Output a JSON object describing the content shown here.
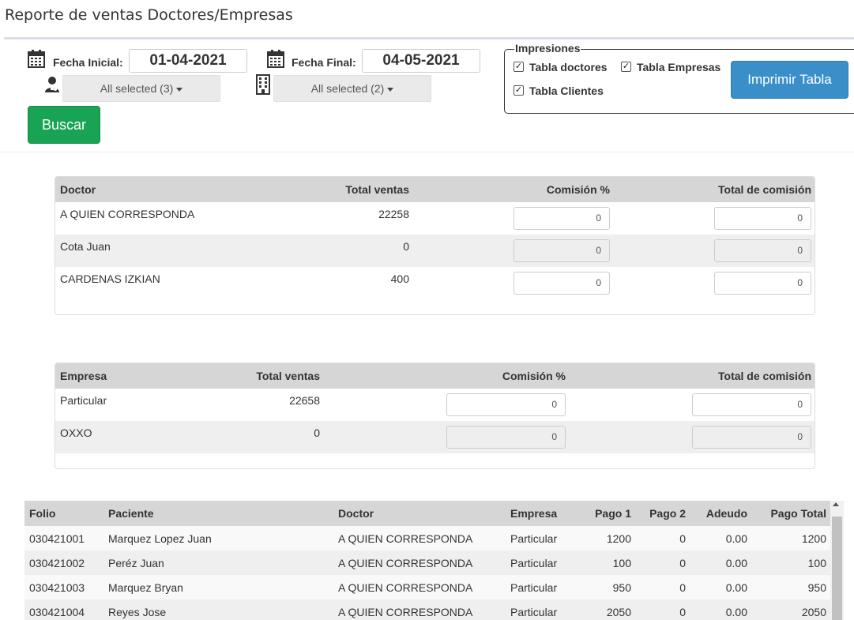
{
  "page": {
    "title": "Reporte de ventas Doctores/Empresas"
  },
  "filters": {
    "fecha_inicial_label": "Fecha Inicial:",
    "fecha_inicial_value": "01-04-2021",
    "fecha_final_label": "Fecha Final:",
    "fecha_final_value": "04-05-2021",
    "doctors_select": "All selected (3)",
    "companies_select": "All selected (2)",
    "buscar_label": "Buscar"
  },
  "impresiones": {
    "legend": "Impresiones",
    "tabla_doctores": "Tabla doctores",
    "tabla_empresas": "Tabla Empresas",
    "tabla_clientes": "Tabla Clientes",
    "check_mark": "✓",
    "print_label": "Imprimir Tabla"
  },
  "doctors_table": {
    "headers": [
      "Doctor",
      "Total ventas",
      "Comisión %",
      "Total de comisión"
    ],
    "rows": [
      {
        "doctor": "A QUIEN CORRESPONDA",
        "total": "22258",
        "comision": "0",
        "total_comision": "0"
      },
      {
        "doctor": "Cota Juan",
        "total": "0",
        "comision": "0",
        "total_comision": "0"
      },
      {
        "doctor": "CARDENAS IZKIAN",
        "total": "400",
        "comision": "0",
        "total_comision": "0"
      }
    ]
  },
  "companies_table": {
    "headers": [
      "Empresa",
      "Total ventas",
      "Comisión %",
      "Total de comisión"
    ],
    "rows": [
      {
        "empresa": "Particular",
        "total": "22658",
        "comision": "0",
        "total_comision": "0"
      },
      {
        "empresa": "OXXO",
        "total": "0",
        "comision": "0",
        "total_comision": "0"
      }
    ]
  },
  "sales_table": {
    "headers": [
      "Folio",
      "Paciente",
      "Doctor",
      "Empresa",
      "Pago 1",
      "Pago 2",
      "Adeudo",
      "Pago Total"
    ],
    "rows": [
      {
        "folio": "030421001",
        "paciente": "Marquez Lopez Juan",
        "doctor": "A QUIEN CORRESPONDA",
        "empresa": "Particular",
        "pago1": "1200",
        "pago2": "0",
        "adeudo": "0.00",
        "total": "1200"
      },
      {
        "folio": "030421002",
        "paciente": "Peréz Juan",
        "doctor": "A QUIEN CORRESPONDA",
        "empresa": "Particular",
        "pago1": "100",
        "pago2": "0",
        "adeudo": "0.00",
        "total": "100"
      },
      {
        "folio": "030421003",
        "paciente": "Marquez Bryan",
        "doctor": "A QUIEN CORRESPONDA",
        "empresa": "Particular",
        "pago1": "950",
        "pago2": "0",
        "adeudo": "0.00",
        "total": "950"
      },
      {
        "folio": "030421004",
        "paciente": "Reyes Jose",
        "doctor": "A QUIEN CORRESPONDA",
        "empresa": "Particular",
        "pago1": "2050",
        "pago2": "0",
        "adeudo": "0.00",
        "total": "2050"
      }
    ]
  },
  "icons": {
    "calendar": "calendar-icon",
    "doctor": "doctor-icon",
    "building": "building-icon"
  }
}
